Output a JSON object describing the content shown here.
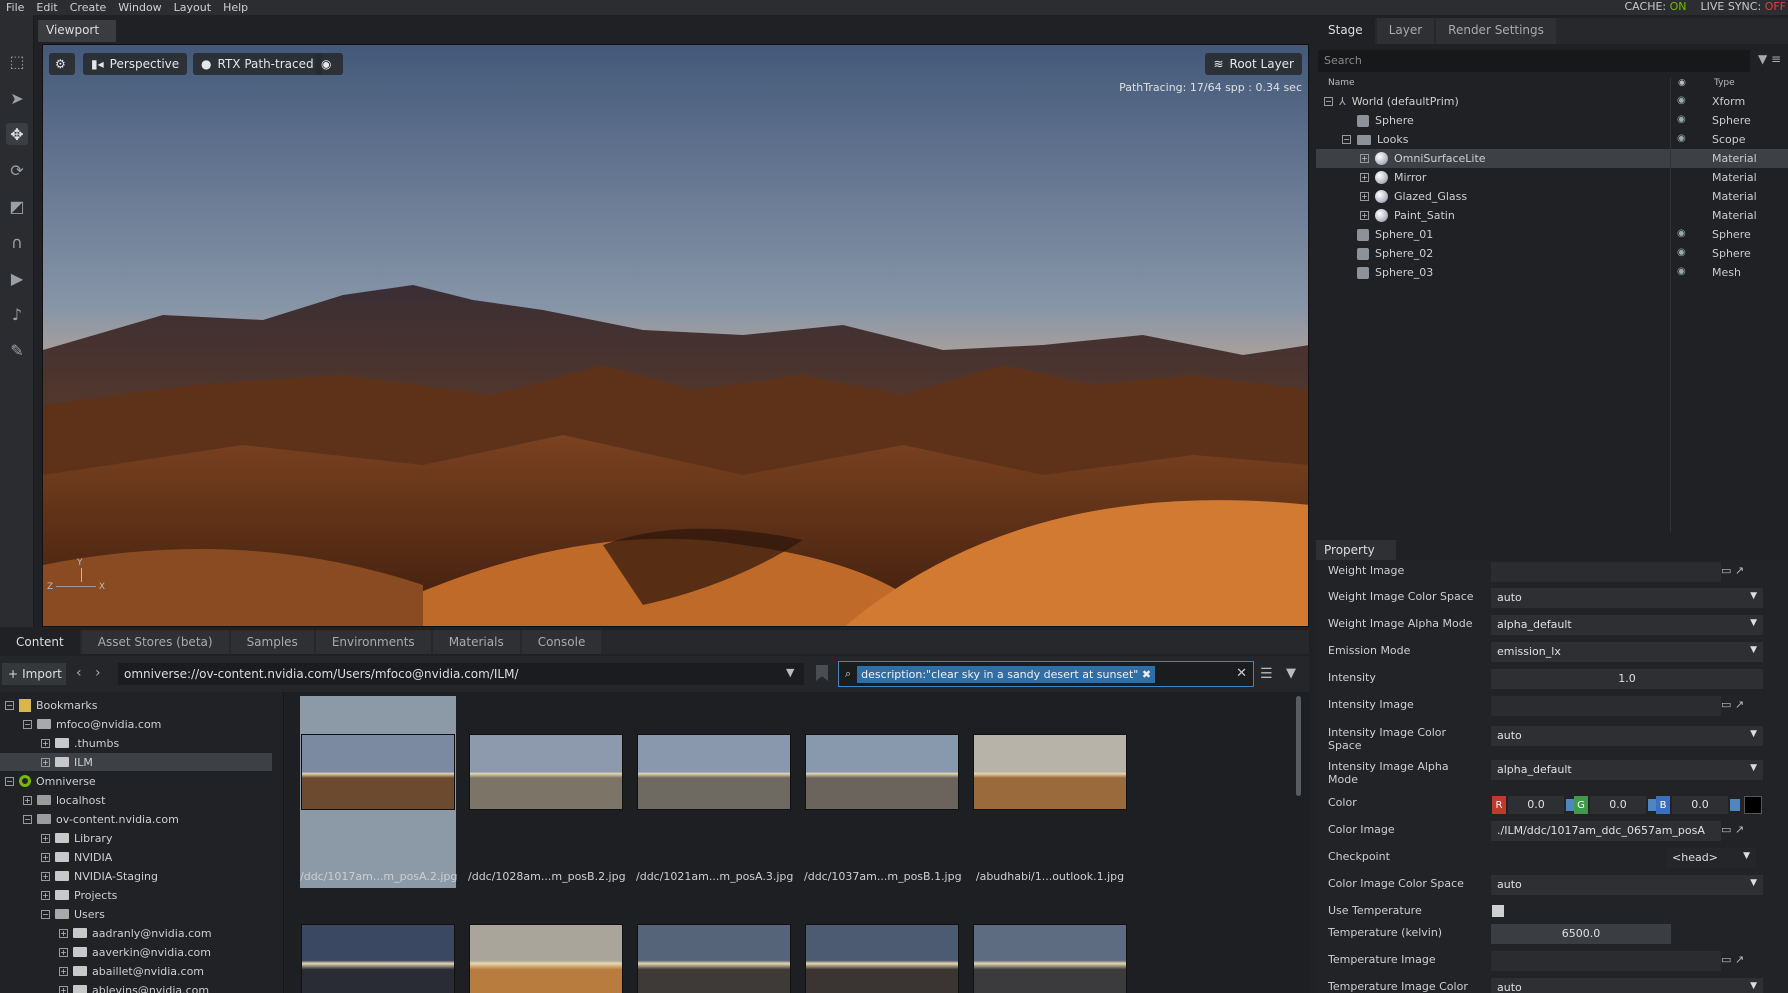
{
  "menubar": {
    "items": [
      "File",
      "Edit",
      "Create",
      "Window",
      "Layout",
      "Help"
    ],
    "cache_label": "CACHE:",
    "cache_value": "ON",
    "sync_label": "LIVE SYNC:",
    "sync_value": "OFF"
  },
  "viewport": {
    "tab": "Viewport",
    "camera": "Perspective",
    "renderer": "RTX Path-traced",
    "root_layer": "Root Layer",
    "status": "PathTracing: 17/64 spp : 0.34 sec",
    "axis_y": "Y",
    "axis_z": "Z",
    "axis_x": "X"
  },
  "bottom_tabs": [
    "Content",
    "Asset Stores (beta)",
    "Samples",
    "Environments",
    "Materials",
    "Console"
  ],
  "content": {
    "import_label": "Import",
    "path": "omniverse://ov-content.nvidia.com/Users/mfoco@nvidia.com/ILM/",
    "search_query": "description:\"clear sky in a sandy desert at sunset\""
  },
  "tree": [
    {
      "label": "Bookmarks",
      "indent": 0,
      "expand": "−",
      "icon": "bookmark"
    },
    {
      "label": "mfoco@nvidia.com",
      "indent": 1,
      "expand": "−",
      "icon": "folder-open"
    },
    {
      "label": ".thumbs",
      "indent": 2,
      "expand": "+",
      "icon": "folder"
    },
    {
      "label": "ILM",
      "indent": 2,
      "expand": "+",
      "icon": "folder",
      "selected": true
    },
    {
      "label": "Omniverse",
      "indent": 0,
      "expand": "−",
      "icon": "omniverse"
    },
    {
      "label": "localhost",
      "indent": 1,
      "expand": "+",
      "icon": "server"
    },
    {
      "label": "ov-content.nvidia.com",
      "indent": 1,
      "expand": "−",
      "icon": "server"
    },
    {
      "label": "Library",
      "indent": 2,
      "expand": "+",
      "icon": "folder"
    },
    {
      "label": "NVIDIA",
      "indent": 2,
      "expand": "+",
      "icon": "folder"
    },
    {
      "label": "NVIDIA-Staging",
      "indent": 2,
      "expand": "+",
      "icon": "folder"
    },
    {
      "label": "Projects",
      "indent": 2,
      "expand": "+",
      "icon": "folder"
    },
    {
      "label": "Users",
      "indent": 2,
      "expand": "−",
      "icon": "folder-open"
    },
    {
      "label": "aadranly@nvidia.com",
      "indent": 3,
      "expand": "+",
      "icon": "folder"
    },
    {
      "label": "aaverkin@nvidia.com",
      "indent": 3,
      "expand": "+",
      "icon": "folder"
    },
    {
      "label": "abaillet@nvidia.com",
      "indent": 3,
      "expand": "+",
      "icon": "folder"
    },
    {
      "label": "ablevins@nvidia.com",
      "indent": 3,
      "expand": "+",
      "icon": "folder"
    }
  ],
  "thumbnails": [
    {
      "caption": "/ddc/1017am...m_posA.2.jpg",
      "selected": true,
      "sky": "#7b8aa0",
      "ground": "#6b4a30"
    },
    {
      "caption": "/ddc/1028am...m_posB.2.jpg",
      "sky": "#8d9aae",
      "ground": "#7d7468"
    },
    {
      "caption": "/ddc/1021am...m_posA.3.jpg",
      "sky": "#8a98ad",
      "ground": "#6e6a62"
    },
    {
      "caption": "/ddc/1037am...m_posB.1.jpg",
      "sky": "#8898ad",
      "ground": "#6a645c"
    },
    {
      "caption": "/abudhabi/1...outlook.1.jpg",
      "sky": "#b7b3a8",
      "ground": "#9b6a3c"
    }
  ],
  "thumbnails_row2": [
    {
      "sky": "#3b4862",
      "ground": "#2a2c35"
    },
    {
      "sky": "#a9a59a",
      "ground": "#b87c3e"
    },
    {
      "sky": "#56647a",
      "ground": "#3e3a38"
    },
    {
      "sky": "#4d5b72",
      "ground": "#3a3532"
    },
    {
      "sky": "#5e6c82",
      "ground": "#3b3a3c"
    }
  ],
  "stage": {
    "tabs": [
      "Stage",
      "Layer",
      "Render Settings"
    ],
    "search_placeholder": "Search",
    "col_name": "Name",
    "col_type": "Type",
    "rows": [
      {
        "name": "World (defaultPrim)",
        "type": "Xform",
        "depth": 0,
        "expand": "−",
        "icon": "xform",
        "eye": true
      },
      {
        "name": "Sphere",
        "type": "Sphere",
        "depth": 1,
        "icon": "cube",
        "eye": true
      },
      {
        "name": "Looks",
        "type": "Scope",
        "depth": 1,
        "expand": "−",
        "icon": "folder",
        "eye": true
      },
      {
        "name": "OmniSurfaceLite",
        "type": "Material",
        "depth": 2,
        "expand": "+",
        "icon": "material",
        "selected": true
      },
      {
        "name": "Mirror",
        "type": "Material",
        "depth": 2,
        "expand": "+",
        "icon": "material"
      },
      {
        "name": "Glazed_Glass",
        "type": "Material",
        "depth": 2,
        "expand": "+",
        "icon": "material"
      },
      {
        "name": "Paint_Satin",
        "type": "Material",
        "depth": 2,
        "expand": "+",
        "icon": "material"
      },
      {
        "name": "Sphere_01",
        "type": "Sphere",
        "depth": 1,
        "icon": "cube",
        "eye": true
      },
      {
        "name": "Sphere_02",
        "type": "Sphere",
        "depth": 1,
        "icon": "cube",
        "eye": true
      },
      {
        "name": "Sphere_03",
        "type": "Mesh",
        "depth": 1,
        "icon": "cube",
        "eye": true
      }
    ]
  },
  "property": {
    "tab": "Property",
    "weight_image": "Weight Image",
    "weight_cs_label": "Weight Image Color Space",
    "weight_cs_value": "auto",
    "weight_alpha_label": "Weight Image Alpha Mode",
    "weight_alpha_value": "alpha_default",
    "emission_label": "Emission Mode",
    "emission_value": "emission_lx",
    "intensity_label": "Intensity",
    "intensity_value": "1.0",
    "intensity_image_label": "Intensity Image",
    "intensity_cs_label": "Intensity Image Color Space",
    "intensity_cs_value": "auto",
    "intensity_alpha_label": "Intensity Image Alpha Mode",
    "intensity_alpha_value": "alpha_default",
    "color_label": "Color",
    "color_r_tag": "R",
    "color_g_tag": "G",
    "color_b_tag": "B",
    "color_r": "0.0",
    "color_g": "0.0",
    "color_b": "0.0",
    "color_image_label": "Color Image",
    "color_image_value": "./ILM/ddc/1017am_ddc_0657am_posA",
    "checkpoint_label": "Checkpoint",
    "checkpoint_value": "<head>",
    "color_cs_label": "Color Image Color Space",
    "color_cs_value": "auto",
    "use_temp_label": "Use Temperature",
    "temp_label": "Temperature (kelvin)",
    "temp_value": "6500.0",
    "temp_image_label": "Temperature Image",
    "temp_image_cs_label": "Temperature Image Color",
    "temp_image_cs_value": "auto"
  }
}
